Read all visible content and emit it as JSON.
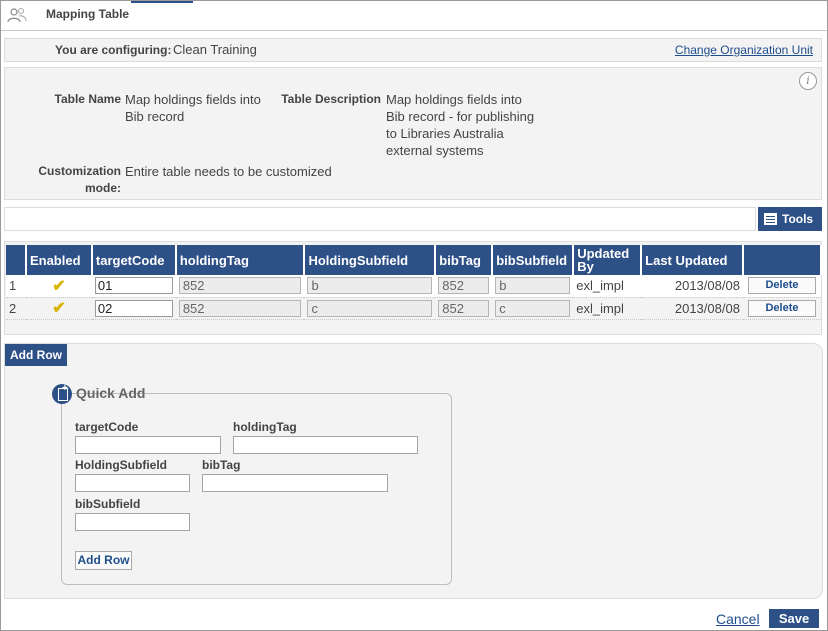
{
  "window": {
    "title": "Mapping Table",
    "logo_icon": "user-group-icon"
  },
  "config": {
    "label": "You are configuring:",
    "value": "Clean Training",
    "change_link": "Change Organization Unit"
  },
  "details": {
    "info_icon": "info-icon",
    "table_name_label": "Table Name",
    "table_name_lines": [
      "Map holdings fields into",
      "Bib record"
    ],
    "table_desc_label": "Table Description",
    "table_desc_lines": [
      "Map holdings fields into",
      "Bib record - for publishing",
      "to Libraries Australia",
      "external systems"
    ],
    "custom_label_lines": [
      "Customization",
      "mode:"
    ],
    "custom_value": "Entire table needs to be customized"
  },
  "toolbar": {
    "tools_label": "Tools",
    "tools_icon": "list-icon"
  },
  "table": {
    "headers": {
      "enabled": "Enabled",
      "targetCode": "targetCode",
      "holdingTag": "holdingTag",
      "holdingSubfield": "HoldingSubfield",
      "bibTag": "bibTag",
      "bibSubfield": "bibSubfield",
      "updatedBy_lines": [
        "Updated",
        "By"
      ],
      "lastUpdated": "Last Updated"
    },
    "rows": [
      {
        "num": "1",
        "enabled_icon": "checkmark-icon",
        "enabled_mark": "✔",
        "targetCode": "01",
        "holdingTag": "852",
        "holdingSubfield": "b",
        "bibTag": "852",
        "bibSubfield": "b",
        "updatedBy": "exl_impl",
        "lastUpdated": "2013/08/08",
        "delete_label": "Delete"
      },
      {
        "num": "2",
        "enabled_icon": "checkmark-icon",
        "enabled_mark": "✔",
        "targetCode": "02",
        "holdingTag": "852",
        "holdingSubfield": "c",
        "bibTag": "852",
        "bibSubfield": "c",
        "updatedBy": "exl_impl",
        "lastUpdated": "2013/08/08",
        "delete_label": "Delete"
      }
    ]
  },
  "add_row": {
    "tab_label": "Add Row",
    "quick_add": {
      "title": "Quick Add",
      "icon": "document-add-icon",
      "fields": {
        "targetCode": {
          "label": "targetCode",
          "value": ""
        },
        "holdingTag": {
          "label": "holdingTag",
          "value": ""
        },
        "holdingSubfield": {
          "label": "HoldingSubfield",
          "value": ""
        },
        "bibTag": {
          "label": "bibTag",
          "value": ""
        },
        "bibSubfield": {
          "label": "bibSubfield",
          "value": ""
        }
      },
      "add_button_label": "Add Row"
    }
  },
  "footer": {
    "cancel_label": "Cancel",
    "save_label": "Save"
  },
  "colors": {
    "accent": "#2d5087",
    "link": "#1f4e8c",
    "panel_bg": "#f3f3f3",
    "check": "#d8b400"
  }
}
